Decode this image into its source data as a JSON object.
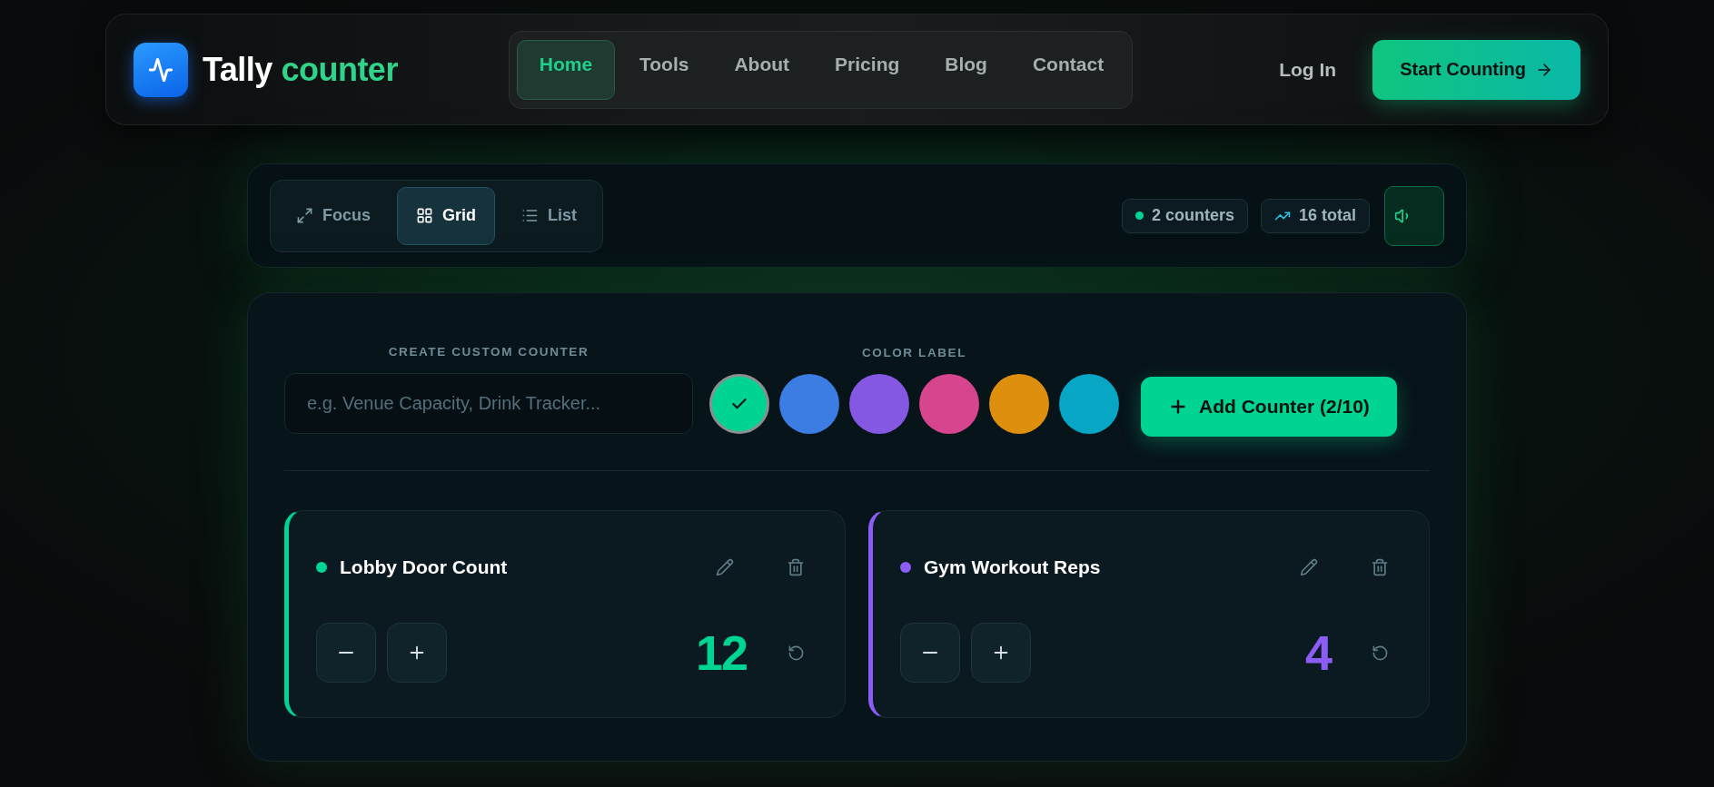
{
  "header": {
    "brand": {
      "name": "Tally",
      "accent": "counter"
    },
    "nav": [
      {
        "label": "Home",
        "selected": true
      },
      {
        "label": "Tools",
        "selected": false
      },
      {
        "label": "About",
        "selected": false
      },
      {
        "label": "Pricing",
        "selected": false
      },
      {
        "label": "Blog",
        "selected": false
      },
      {
        "label": "Contact",
        "selected": false
      }
    ],
    "login": "Log In",
    "cta": "Start Counting"
  },
  "toolbar": {
    "views": [
      {
        "label": "Focus",
        "kind": "focus",
        "selected": false
      },
      {
        "label": "Grid",
        "kind": "grid",
        "selected": true
      },
      {
        "label": "List",
        "kind": "list",
        "selected": false
      }
    ],
    "stats": [
      {
        "label": "2 counters",
        "kind": "dot"
      },
      {
        "label": "16 total",
        "kind": "trend"
      }
    ]
  },
  "create": {
    "name_label": "CREATE CUSTOM COUNTER",
    "placeholder": "e.g. Venue Capacity, Drink Tracker...",
    "color_label": "COLOR LABEL",
    "colors": [
      {
        "color": "#00d492",
        "selected": true
      },
      {
        "color": "#3b7de3",
        "selected": false
      },
      {
        "color": "#8558e3",
        "selected": false
      },
      {
        "color": "#d6458e",
        "selected": false
      },
      {
        "color": "#df8f0e",
        "selected": false
      },
      {
        "color": "#06a6c4",
        "selected": false
      }
    ],
    "add_button": "Add Counter (2/10)"
  },
  "counters": [
    {
      "name": "Lobby Door Count",
      "value": "12",
      "color": "#00d492"
    },
    {
      "name": "Gym Workout Reps",
      "value": "4",
      "color": "#8b5cf6"
    }
  ]
}
